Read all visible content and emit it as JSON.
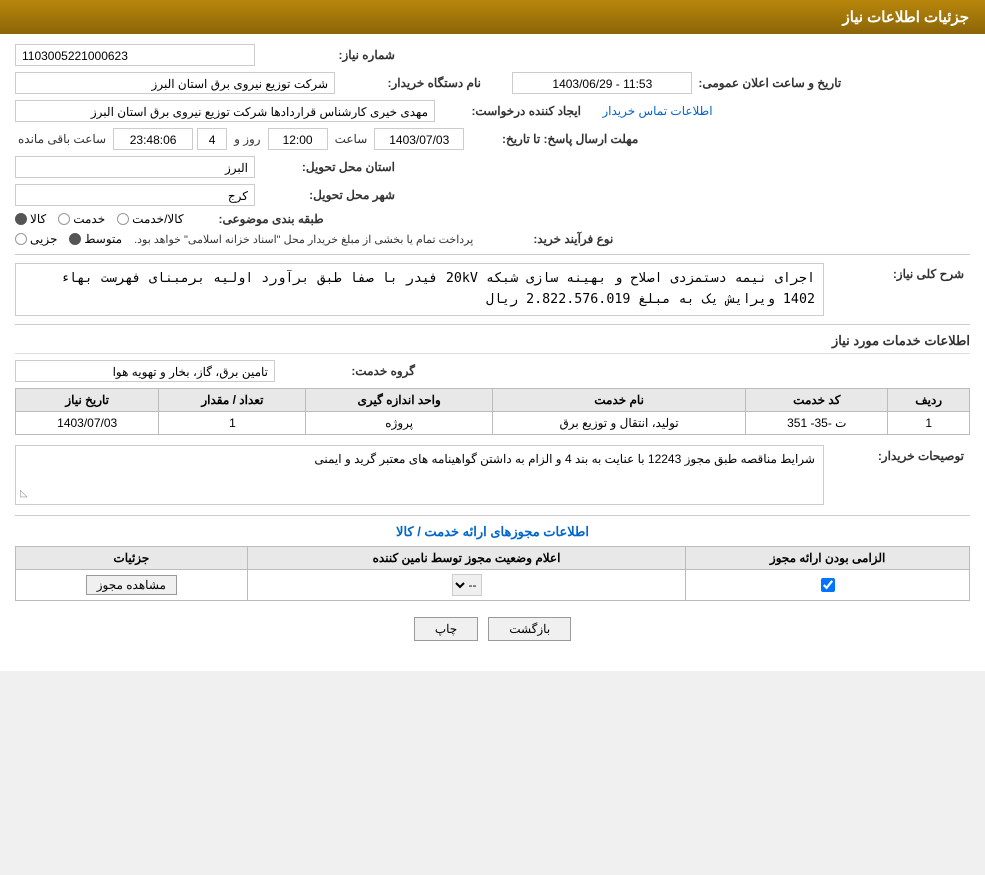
{
  "header": {
    "title": "جزئیات اطلاعات نیاز"
  },
  "fields": {
    "request_number_label": "شماره نیاز:",
    "request_number_value": "1103005221000623",
    "buyer_org_label": "نام دستگاه خریدار:",
    "buyer_org_value": "شرکت توزیع نیروی برق استان البرز",
    "announcement_date_label": "تاریخ و ساعت اعلان عمومی:",
    "announcement_date_value": "1403/06/29 - 11:53",
    "creator_label": "ایجاد کننده درخواست:",
    "creator_value": "مهدی خیری کارشناس قراردادها شرکت توزیع نیروی برق استان البرز",
    "contact_link": "اطلاعات تماس خریدار",
    "deadline_label": "مهلت ارسال پاسخ: تا تاریخ:",
    "deadline_date": "1403/07/03",
    "deadline_time_label": "ساعت",
    "deadline_time": "12:00",
    "deadline_days_label": "روز و",
    "deadline_days": "4",
    "deadline_remaining_label": "ساعت باقی مانده",
    "deadline_remaining": "23:48:06",
    "province_label": "استان محل تحویل:",
    "province_value": "البرز",
    "city_label": "شهر محل تحویل:",
    "city_value": "کرج",
    "category_label": "طبقه بندی موضوعی:",
    "category_options": [
      "کالا",
      "خدمت",
      "کالا/خدمت"
    ],
    "category_selected": "کالا",
    "purchase_type_label": "نوع فرآیند خرید:",
    "purchase_type_options": [
      "جزیی",
      "متوسط"
    ],
    "purchase_type_selected": "متوسط",
    "purchase_type_note": "پرداخت تمام یا بخشی از مبلغ خریدار محل \"اسناد خزانه اسلامی\" خواهد بود.",
    "narration_label": "شرح کلی نیاز:",
    "narration_value": "اجرای نیمه دستمزدی اصلاح و بهینه سازی شبکه 20kV فیدر با صفا طبق برآورد اولیه برمبنای فهرست بهاء 1402 ویرایش یک به مبلغ 2.822.576.019 ریال"
  },
  "services_section": {
    "title": "اطلاعات خدمات مورد نیاز",
    "service_group_label": "گروه خدمت:",
    "service_group_value": "تامین برق، گاز، بخار و تهویه هوا",
    "table": {
      "columns": [
        "ردیف",
        "کد خدمت",
        "نام خدمت",
        "واحد اندازه گیری",
        "تعداد / مقدار",
        "تاریخ نیاز"
      ],
      "rows": [
        {
          "row": "1",
          "service_code": "ت -35- 351",
          "service_name": "تولید، انتقال و توزیع برق",
          "unit": "پروژه",
          "quantity": "1",
          "need_date": "1403/07/03"
        }
      ]
    }
  },
  "buyer_comments": {
    "label": "توصیحات خریدار:",
    "value": "شرایط مناقصه طبق مجوز 12243 با عنایت به بند 4 و الزام به داشتن گواهینامه های معتبر گرید و ایمنی"
  },
  "license_section": {
    "title": "اطلاعات مجوزهای ارائه خدمت / کالا",
    "table": {
      "columns": [
        "الزامی بودن ارائه مجوز",
        "اعلام وضعیت مجوز توسط نامین کننده",
        "جزئیات"
      ],
      "rows": [
        {
          "required": true,
          "status_value": "--",
          "details_label": "مشاهده مجوز"
        }
      ]
    }
  },
  "buttons": {
    "print_label": "چاپ",
    "back_label": "بازگشت"
  }
}
